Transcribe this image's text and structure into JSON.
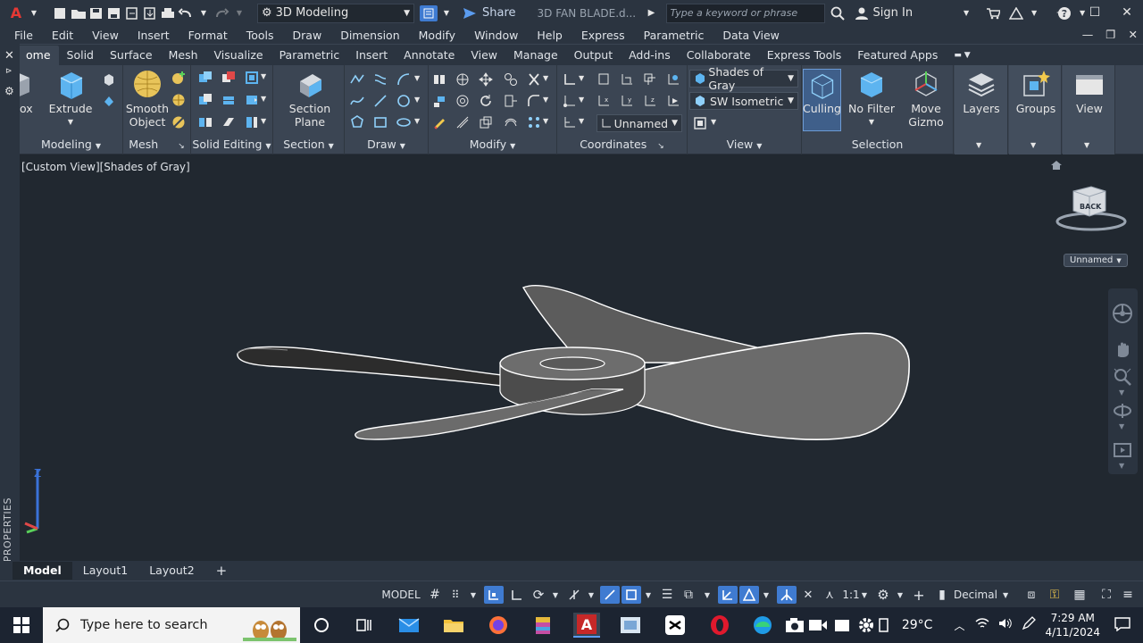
{
  "titlebar": {
    "workspace": "3D Modeling",
    "share_label": "Share",
    "document_title": "3D FAN BLADE.d...",
    "search_placeholder": "Type a keyword or phrase",
    "signin_label": "Sign In"
  },
  "menubar": {
    "items": [
      "File",
      "Edit",
      "View",
      "Insert",
      "Format",
      "Tools",
      "Draw",
      "Dimension",
      "Modify",
      "Window",
      "Help",
      "Express",
      "Parametric",
      "Data View"
    ]
  },
  "ribbon_tabs": [
    "ome",
    "Solid",
    "Surface",
    "Mesh",
    "Visualize",
    "Parametric",
    "Insert",
    "Annotate",
    "View",
    "Manage",
    "Output",
    "Add-ins",
    "Collaborate",
    "Express Tools",
    "Featured Apps"
  ],
  "ribbon": {
    "box_label": "Box",
    "extrude_label": "Extrude",
    "smooth_label_1": "Smooth",
    "smooth_label_2": "Object",
    "section_plane_1": "Section",
    "section_plane_2": "Plane",
    "visual_style": "Shades of Gray",
    "view_preset": "SW Isometric",
    "ucs_name": "Unnamed",
    "culling_label": "Culling",
    "no_filter_label": "No Filter",
    "move_gizmo_1": "Move",
    "move_gizmo_2": "Gizmo",
    "layers_label": "Layers",
    "groups_label": "Groups",
    "view_label": "View",
    "panels": {
      "modeling": "Modeling",
      "mesh": "Mesh",
      "solid_editing": "Solid Editing",
      "section": "Section",
      "draw": "Draw",
      "modify": "Modify",
      "coordinates": "Coordinates",
      "view": "View",
      "selection": "Selection"
    }
  },
  "viewport": {
    "label": "[Custom View][Shades of Gray]",
    "viewcube_face": "BACK",
    "ucs_pill": "Unnamed",
    "properties_label": "PROPERTIES"
  },
  "layout_tabs": [
    "Model",
    "Layout1",
    "Layout2"
  ],
  "statusbar": {
    "model_label": "MODEL",
    "scale": "1:1",
    "units": "Decimal"
  },
  "taskbar": {
    "search_placeholder": "Type here to search",
    "temperature": "29°C",
    "time": "7:29 AM",
    "date": "4/11/2024"
  },
  "colors": {
    "accent": "#3f7bd1",
    "autocad_red": "#e53935",
    "blade_fill": "#6b6b6b",
    "background": "#212830"
  }
}
